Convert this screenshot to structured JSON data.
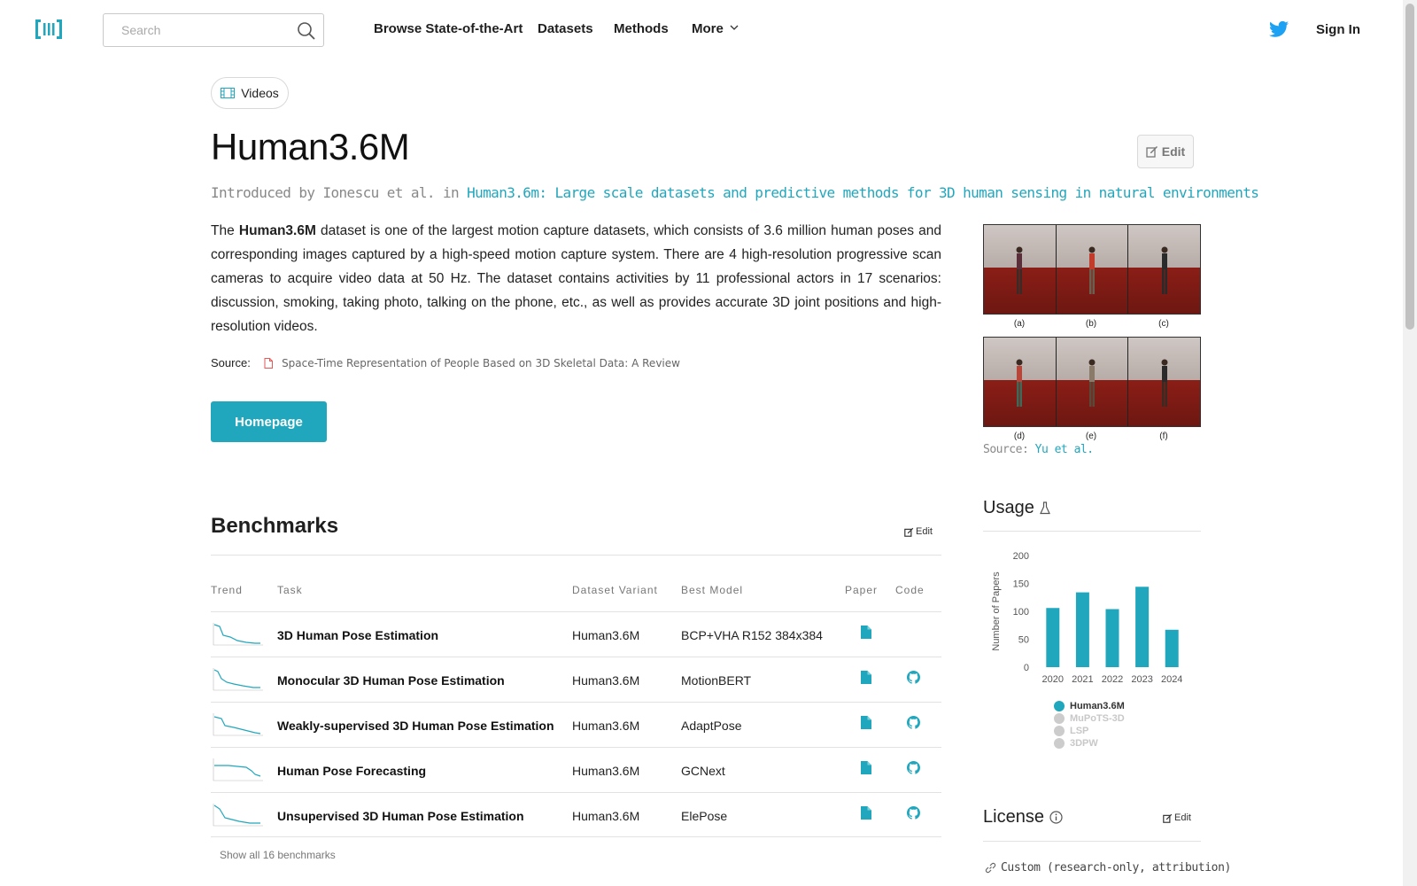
{
  "nav": {
    "search_placeholder": "Search",
    "links": [
      "Browse State-of-the-Art",
      "Datasets",
      "Methods",
      "More"
    ],
    "signin": "Sign In"
  },
  "modality": {
    "label": "Videos",
    "icon": "film-icon"
  },
  "title": "Human3.6M",
  "edit_label": "Edit",
  "intro": {
    "prefix": "Introduced by Ionescu et al. in",
    "paper": "Human3.6m: Large scale datasets and predictive methods for 3D human sensing in natural environments"
  },
  "description": {
    "pre": "The",
    "bold": "Human3.6M",
    "post": "dataset is one of the largest motion capture datasets, which consists of 3.6 million human poses and corresponding images captured by a high-speed motion capture system. There are 4 high-resolution progressive scan cameras to acquire video data at 50 Hz. The dataset contains activities by 11 professional actors in 17 scenarios: discussion, smoking, taking photo, talking on the phone, etc., as well as provides accurate 3D joint positions and high-resolution videos."
  },
  "source": {
    "label": "Source:",
    "title": "Space-Time Representation of People Based on 3D Skeletal Data: A Review"
  },
  "homepage_label": "Homepage",
  "figure": {
    "captions": [
      "(a)",
      "(b)",
      "(c)",
      "(d)",
      "(e)",
      "(f)"
    ],
    "source_label": "Source:",
    "source_link": "Yu et al."
  },
  "benchmarks": {
    "title": "Benchmarks",
    "edit_label": "Edit",
    "headers": {
      "trend": "Trend",
      "task": "Task",
      "variant": "Dataset Variant",
      "best": "Best Model",
      "paper": "Paper",
      "code": "Code"
    },
    "rows": [
      {
        "task": "3D Human Pose Estimation",
        "variant": "Human3.6M",
        "best": "BCP+VHA R152 384x384",
        "paper": true,
        "code": false
      },
      {
        "task": "Monocular 3D Human Pose Estimation",
        "variant": "Human3.6M",
        "best": "MotionBERT",
        "paper": true,
        "code": true
      },
      {
        "task": "Weakly-supervised 3D Human Pose Estimation",
        "variant": "Human3.6M",
        "best": "AdaptPose",
        "paper": true,
        "code": true
      },
      {
        "task": "Human Pose Forecasting",
        "variant": "Human3.6M",
        "best": "GCNext",
        "paper": true,
        "code": true
      },
      {
        "task": "Unsupervised 3D Human Pose Estimation",
        "variant": "Human3.6M",
        "best": "ElePose",
        "paper": true,
        "code": true
      }
    ],
    "show_all": "Show all 16 benchmarks"
  },
  "usage": {
    "title": "Usage",
    "icon": "flask-icon"
  },
  "license": {
    "title": "License",
    "edit_label": "Edit",
    "value": "Custom (research-only, attribution)",
    "icon": "link-icon"
  },
  "colors": {
    "accent": "#21a7bd",
    "legend_inactive": "#cccccc"
  },
  "chart_data": {
    "type": "bar",
    "ylabel": "Number of Papers",
    "categories": [
      "2020",
      "2021",
      "2022",
      "2023",
      "2024"
    ],
    "yticks": [
      0,
      50,
      100,
      150,
      200
    ],
    "ylim": [
      0,
      200
    ],
    "series": [
      {
        "name": "Human3.6M",
        "values": [
          106,
          134,
          104,
          144,
          67
        ],
        "active": true
      },
      {
        "name": "MuPoTS-3D",
        "values": null,
        "active": false
      },
      {
        "name": "LSP",
        "values": null,
        "active": false
      },
      {
        "name": "3DPW",
        "values": null,
        "active": false
      }
    ],
    "legend": "bottom"
  }
}
